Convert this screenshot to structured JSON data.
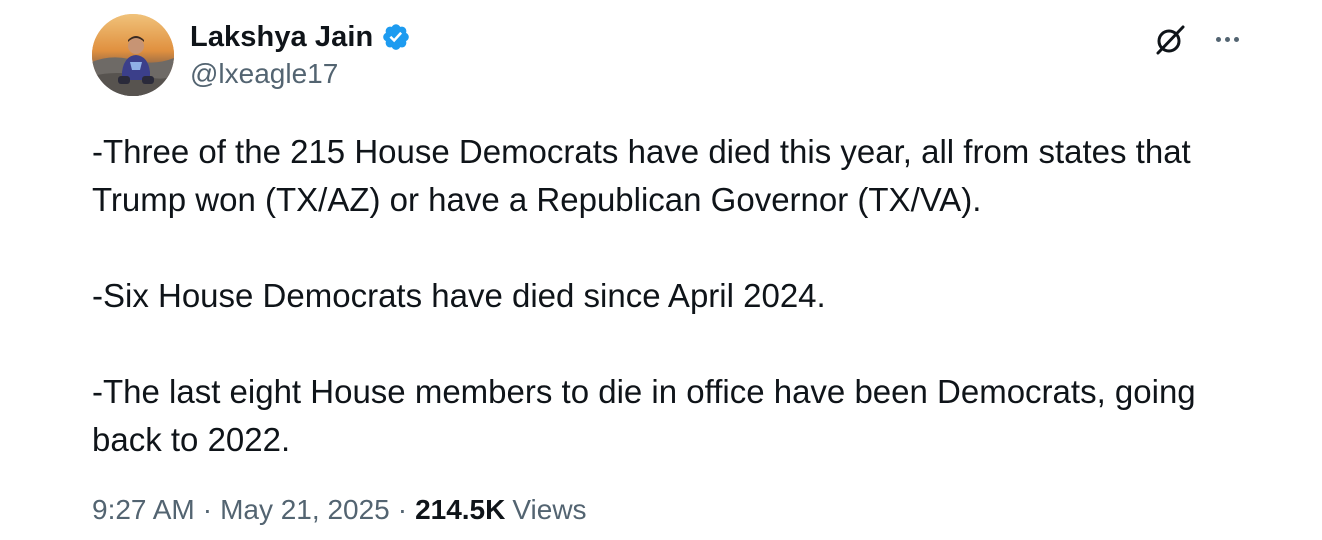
{
  "author": {
    "display_name": "Lakshya Jain",
    "handle": "@lxeagle17",
    "verified": true,
    "verified_color": "#1d9bf0"
  },
  "tweet": {
    "paragraphs": [
      "-Three of the 215 House Democrats have died this year, all from states that Trump won (TX/AZ) or have a Republican Governor (TX/VA).",
      "-Six House Democrats have died since April 2024.",
      "-The last eight House members to die in office have been Democrats, going back to 2022."
    ]
  },
  "meta": {
    "time": "9:27 AM",
    "separator": "·",
    "date": "May 21, 2025",
    "views_count": "214.5K",
    "views_label": "Views"
  },
  "icons": {
    "grok": "grok-icon",
    "more": "more-options-icon",
    "verified": "verified-badge-icon"
  },
  "colors": {
    "text_primary": "#0f1419",
    "text_secondary": "#536471",
    "accent": "#1d9bf0"
  }
}
